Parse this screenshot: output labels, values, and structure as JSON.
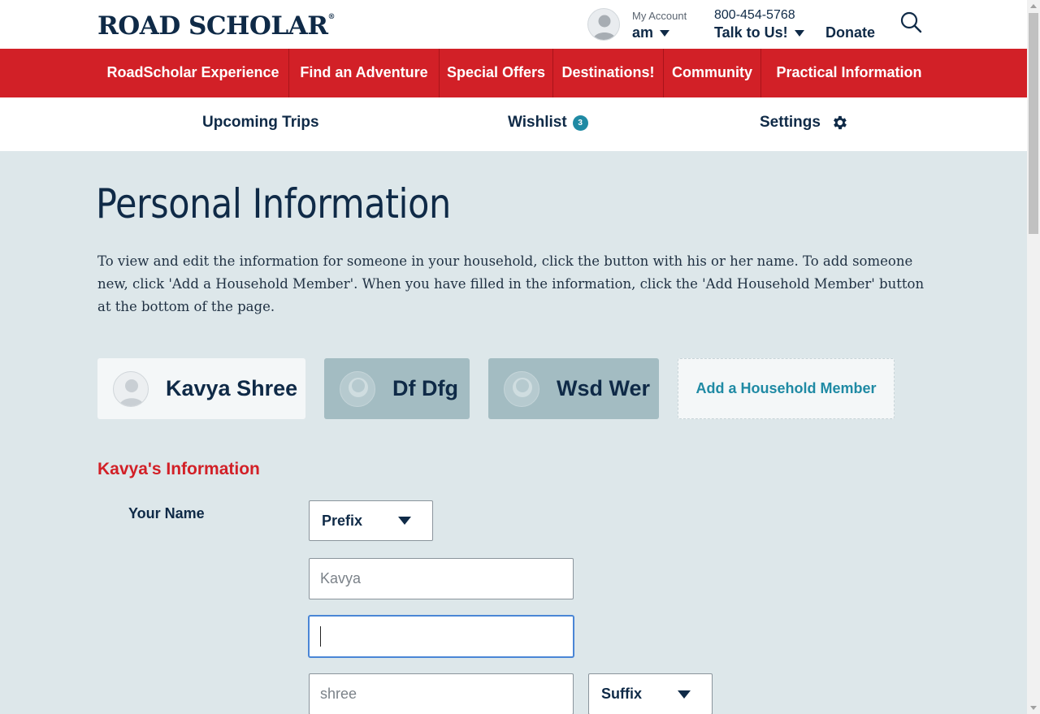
{
  "header": {
    "logo": "ROAD SCHOLAR",
    "logo_mark": "®",
    "account_small": "My Account",
    "account_name": "am",
    "phone": "800-454-5768",
    "talk_label": "Talk to Us!",
    "donate_label": "Donate"
  },
  "nav": {
    "items": [
      "RoadScholar Experience",
      "Find an Adventure",
      "Special Offers",
      "Destinations!",
      "Community",
      "Practical Information"
    ]
  },
  "subnav": {
    "upcoming": "Upcoming Trips",
    "wishlist": "Wishlist",
    "wishlist_count": "3",
    "settings": "Settings"
  },
  "main": {
    "title": "Personal Information",
    "intro": "To view and edit the information for someone in your household, click the button with his or her name. To add someone new, click 'Add a Household Member'. When you have filled in the information, click the 'Add Household Member' button at the bottom of the page.",
    "members": [
      "Kavya Shree",
      "Df Dfg",
      "Wsd Wer"
    ],
    "add_member_label": "Add a Household Member",
    "section_title": "Kavya's Information",
    "your_name_label": "Your Name",
    "prefix_value": "Prefix",
    "first_name_placeholder": "Kavya",
    "middle_name_value": "",
    "last_name_placeholder": "shree",
    "suffix_value": "Suffix"
  },
  "colors": {
    "brand_red": "#d22027",
    "navy": "#0f2a47",
    "teal": "#1f8aa4",
    "page_bg": "#dde7ea"
  }
}
